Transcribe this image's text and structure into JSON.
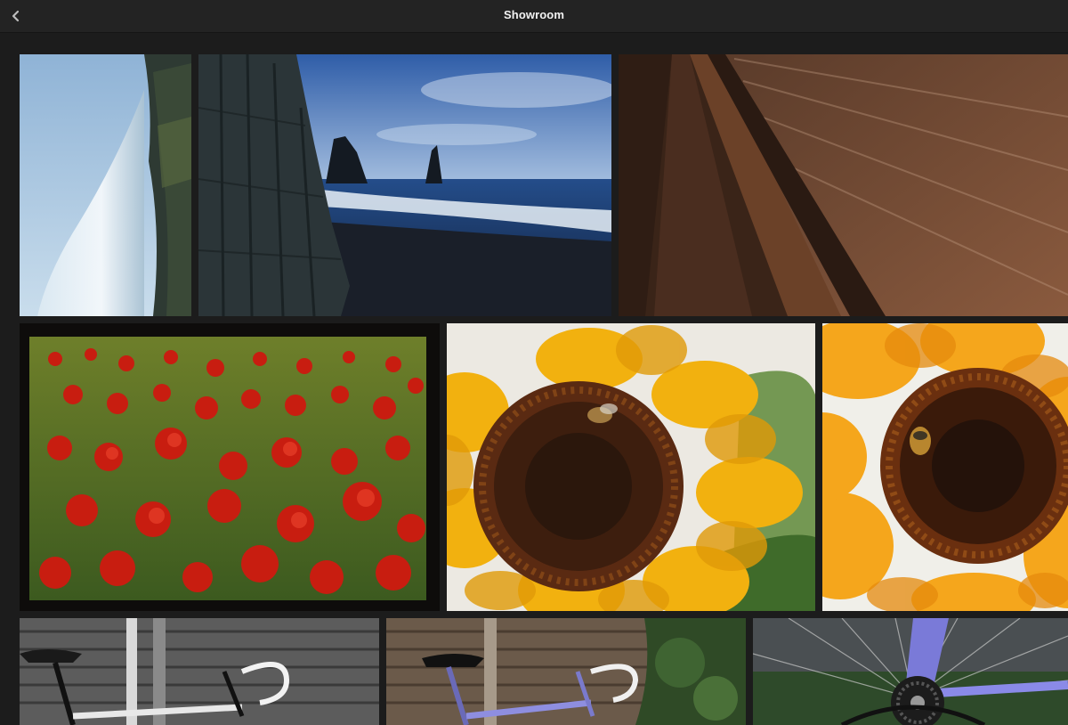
{
  "window": {
    "title": "Showroom",
    "back_icon": "chevron-left-icon"
  },
  "gallery": {
    "photos": [
      {
        "subject": "waterfall-cliff"
      },
      {
        "subject": "basalt-coast-sea-stacks"
      },
      {
        "subject": "rusty-rails"
      },
      {
        "subject": "poppy-field"
      },
      {
        "subject": "sunflower-with-bee"
      },
      {
        "subject": "sunflower-closeup"
      },
      {
        "subject": "bicycle-monochrome"
      },
      {
        "subject": "bicycle-fence"
      },
      {
        "subject": "bicycle-wheel"
      }
    ]
  },
  "colors": {
    "background": "#1c1c1c",
    "titlebar": "#232323",
    "title_text": "#f2f2f2"
  }
}
